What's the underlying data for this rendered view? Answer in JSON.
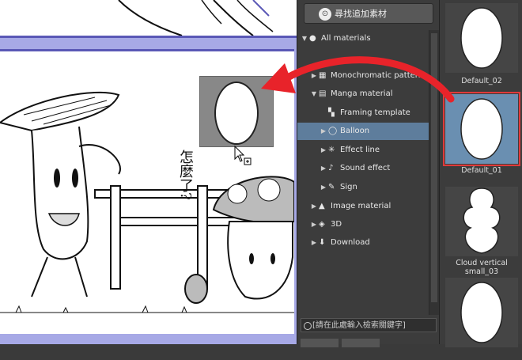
{
  "canvas": {
    "question_text": "怎麼了?"
  },
  "material_panel": {
    "search_button_label": "尋找追加素材",
    "tree": [
      {
        "label": "All materials",
        "arrow": "▼",
        "indent": 0,
        "icon": "globe-icon",
        "selected": false
      },
      {
        "label": "Monochromatic pattern",
        "arrow": "▶",
        "indent": 1,
        "icon": "pattern-icon",
        "selected": false
      },
      {
        "label": "Manga material",
        "arrow": "▼",
        "indent": 1,
        "icon": "manga-icon",
        "selected": false
      },
      {
        "label": "Framing template",
        "arrow": "",
        "indent": 2,
        "icon": "frame-icon",
        "selected": false
      },
      {
        "label": "Balloon",
        "arrow": "▶",
        "indent": 2,
        "icon": "balloon-icon",
        "selected": true
      },
      {
        "label": "Effect line",
        "arrow": "▶",
        "indent": 2,
        "icon": "effect-line-icon",
        "selected": false
      },
      {
        "label": "Sound effect",
        "arrow": "▶",
        "indent": 2,
        "icon": "sound-effect-icon",
        "selected": false
      },
      {
        "label": "Sign",
        "arrow": "▶",
        "indent": 2,
        "icon": "sign-icon",
        "selected": false
      },
      {
        "label": "Image material",
        "arrow": "▶",
        "indent": 1,
        "icon": "image-icon",
        "selected": false
      },
      {
        "label": "3D",
        "arrow": "▶",
        "indent": 1,
        "icon": "cube-icon",
        "selected": false
      },
      {
        "label": "Download",
        "arrow": "▶",
        "indent": 1,
        "icon": "download-icon",
        "selected": false
      }
    ],
    "keyword_placeholder": "[請在此處輸入檢索關鍵字]"
  },
  "thumbnails": [
    {
      "label": "Default_02",
      "selected": false
    },
    {
      "label": "Default_01",
      "selected": true
    },
    {
      "label": "Cloud vertical small_03",
      "selected": false
    },
    {
      "label": "",
      "selected": false
    }
  ],
  "colors": {
    "frame_border": "#5a58b6",
    "canvas_bg": "#a7a9e6",
    "selection_bg": "#5e7d9c",
    "highlight_red": "#e03a3a",
    "arrow_red": "#e8232a"
  }
}
